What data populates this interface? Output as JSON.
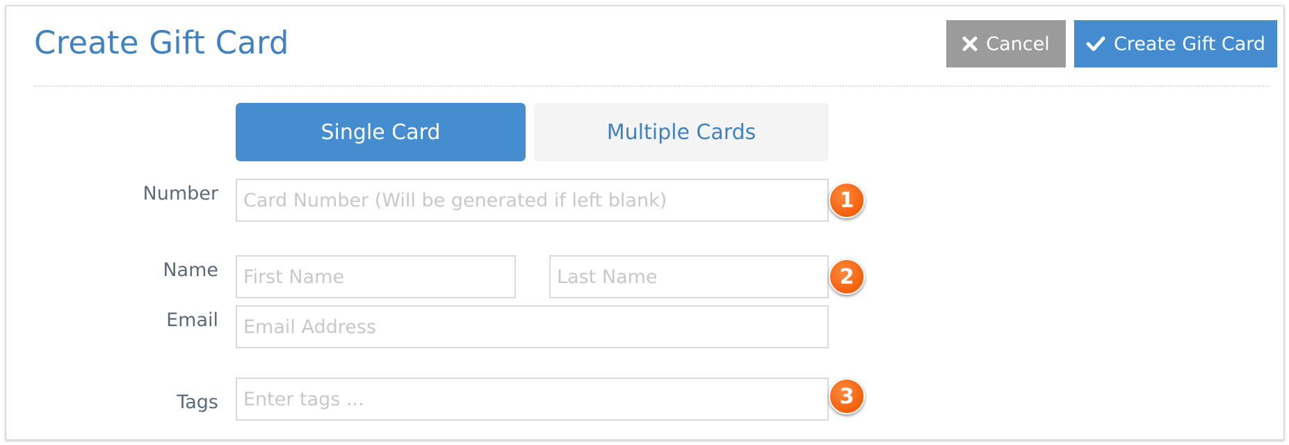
{
  "header": {
    "title": "Create Gift Card",
    "cancel_label": "Cancel",
    "create_label": "Create Gift Card"
  },
  "mode_toggle": {
    "single_label": "Single Card",
    "multiple_label": "Multiple Cards",
    "selected": "Single Card"
  },
  "form": {
    "number": {
      "label": "Number",
      "placeholder": "Card Number (Will be generated if left blank)",
      "value": ""
    },
    "name": {
      "label": "Name",
      "first_placeholder": "First Name",
      "last_placeholder": "Last Name",
      "first_value": "",
      "last_value": ""
    },
    "email": {
      "label": "Email",
      "placeholder": "Email Address",
      "value": ""
    },
    "tags": {
      "label": "Tags",
      "placeholder": "Enter tags ...",
      "value": ""
    }
  },
  "annotations": {
    "markers": [
      "1",
      "2",
      "3"
    ],
    "marker_color": "#f3600c"
  },
  "colors": {
    "accent": "#448ccf",
    "title": "#3f82c1",
    "cancel": "#9b9b9b"
  },
  "icons": {
    "cancel": "close-icon",
    "create": "checkmark-icon"
  }
}
